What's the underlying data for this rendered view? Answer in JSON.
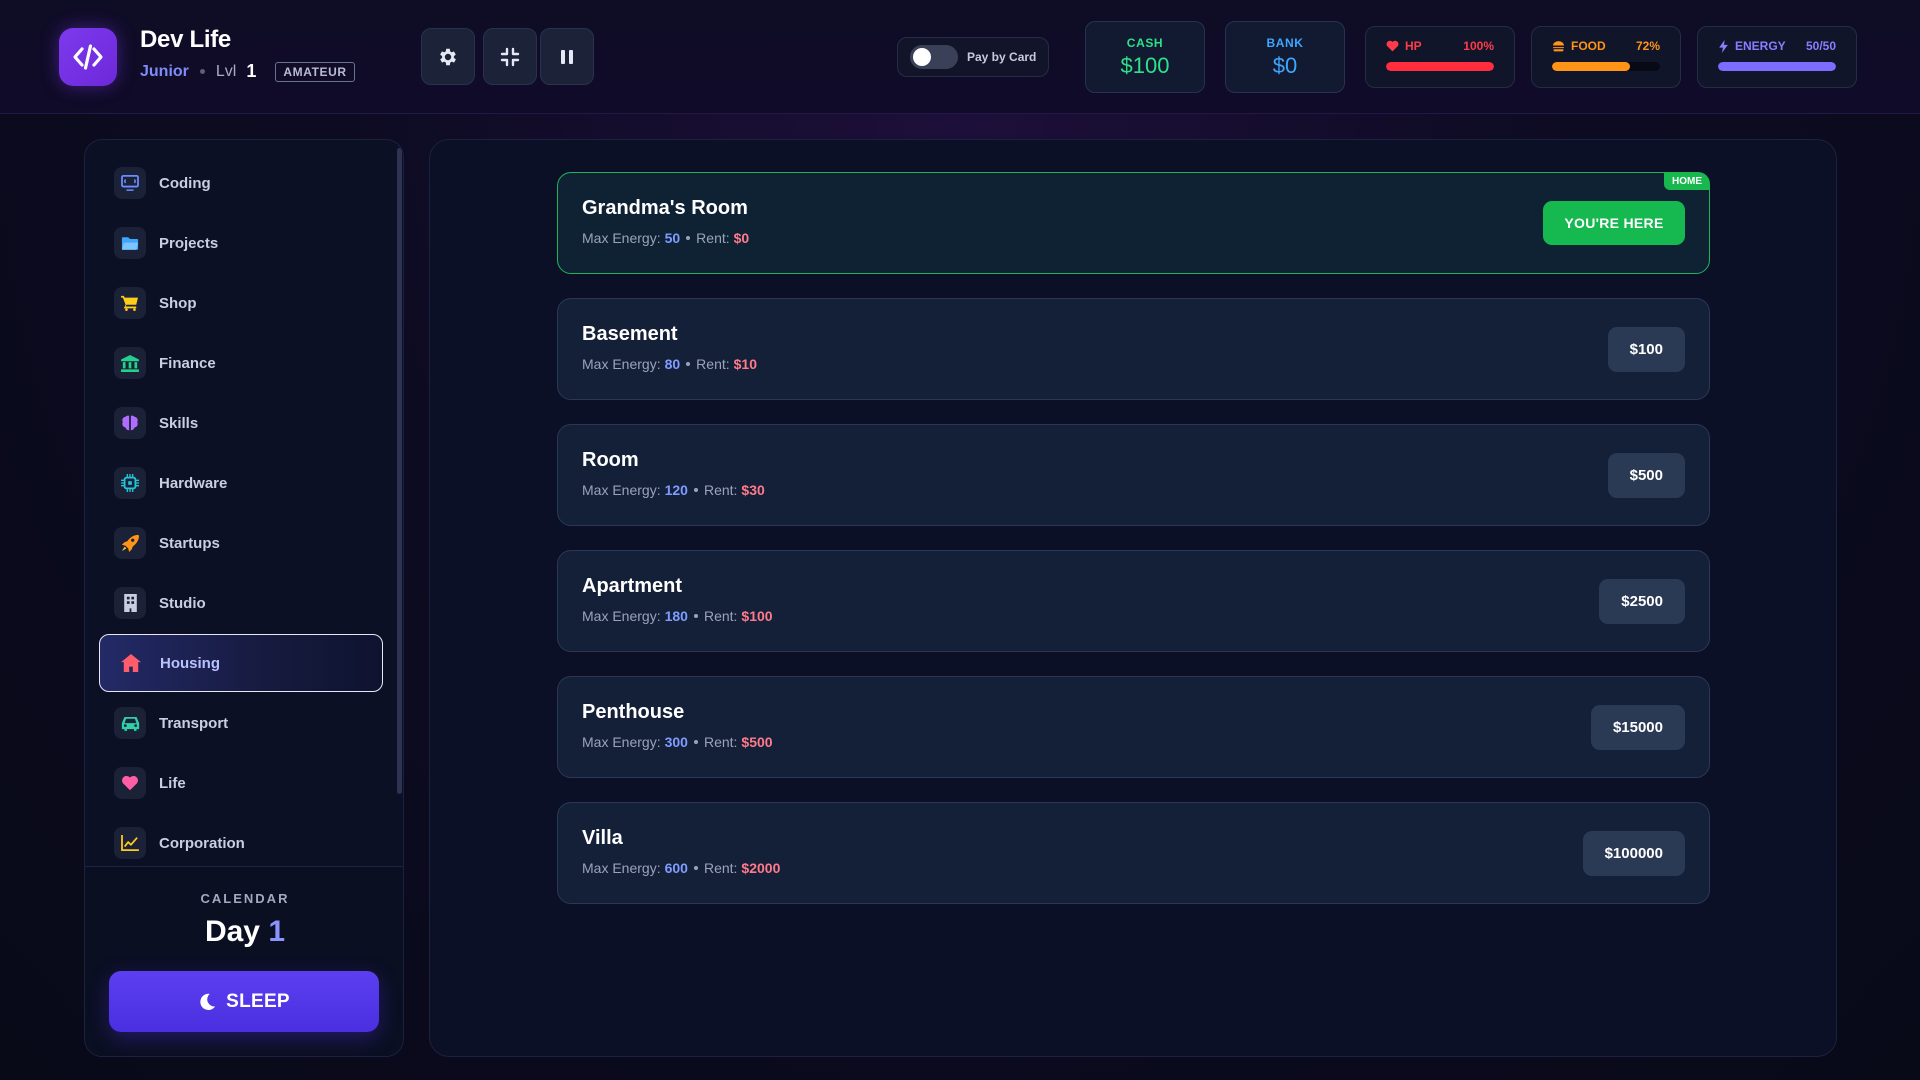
{
  "header": {
    "app_title": "Dev Life",
    "rank": "Junior",
    "level_label": "Lvl",
    "level_value": "1",
    "tier_badge": "AMATEUR",
    "pay_by_card_label": "Pay by Card",
    "pay_by_card_on": false,
    "cash": {
      "label": "CASH",
      "value": "$100",
      "color": "#2fe08a"
    },
    "bank": {
      "label": "BANK",
      "value": "$0",
      "color": "#3ea6ff"
    },
    "hp": {
      "label": "HP",
      "value": "100%",
      "level": 1.0,
      "color": "#ff2d3d"
    },
    "food": {
      "label": "FOOD",
      "value": "72%",
      "level": 0.72,
      "color": "#ff9417"
    },
    "energy": {
      "label": "ENERGY",
      "value": "50/50",
      "level": 1.0,
      "color": "#7c6cff"
    }
  },
  "sidebar": {
    "items": [
      {
        "label": "Coding",
        "icon": "monitor-icon",
        "color": "#6c8cff"
      },
      {
        "label": "Projects",
        "icon": "folder-icon",
        "color": "#3ea6ff"
      },
      {
        "label": "Shop",
        "icon": "cart-icon",
        "color": "#ffcc1a"
      },
      {
        "label": "Finance",
        "icon": "bank-icon",
        "color": "#23d18b"
      },
      {
        "label": "Skills",
        "icon": "brain-icon",
        "color": "#b06cff"
      },
      {
        "label": "Hardware",
        "icon": "chip-icon",
        "color": "#22c5d8"
      },
      {
        "label": "Startups",
        "icon": "rocket-icon",
        "color": "#ff9417"
      },
      {
        "label": "Studio",
        "icon": "building-icon",
        "color": "#c9cee0"
      },
      {
        "label": "Housing",
        "icon": "home-icon",
        "color": "#ff5d6c",
        "active": true
      },
      {
        "label": "Transport",
        "icon": "car-icon",
        "color": "#2fd0a8"
      },
      {
        "label": "Life",
        "icon": "heart-icon",
        "color": "#ff5da6"
      },
      {
        "label": "Corporation",
        "icon": "chart-icon",
        "color": "#ffcc1a"
      }
    ],
    "calendar_label": "CALENDAR",
    "day_label": "Day",
    "day_value": "1",
    "sleep_label": "SLEEP"
  },
  "housing": {
    "max_energy_label": "Max Energy:",
    "rent_label": "Rent:",
    "here_label": "YOU'RE HERE",
    "home_badge": "HOME",
    "items": [
      {
        "name": "Grandma's Room",
        "max_energy": "50",
        "rent": "$0",
        "price": "",
        "current": true
      },
      {
        "name": "Basement",
        "max_energy": "80",
        "rent": "$10",
        "price": "$100"
      },
      {
        "name": "Room",
        "max_energy": "120",
        "rent": "$30",
        "price": "$500"
      },
      {
        "name": "Apartment",
        "max_energy": "180",
        "rent": "$100",
        "price": "$2500"
      },
      {
        "name": "Penthouse",
        "max_energy": "300",
        "rent": "$500",
        "price": "$15000"
      },
      {
        "name": "Villa",
        "max_energy": "600",
        "rent": "$2000",
        "price": "$100000"
      }
    ]
  }
}
